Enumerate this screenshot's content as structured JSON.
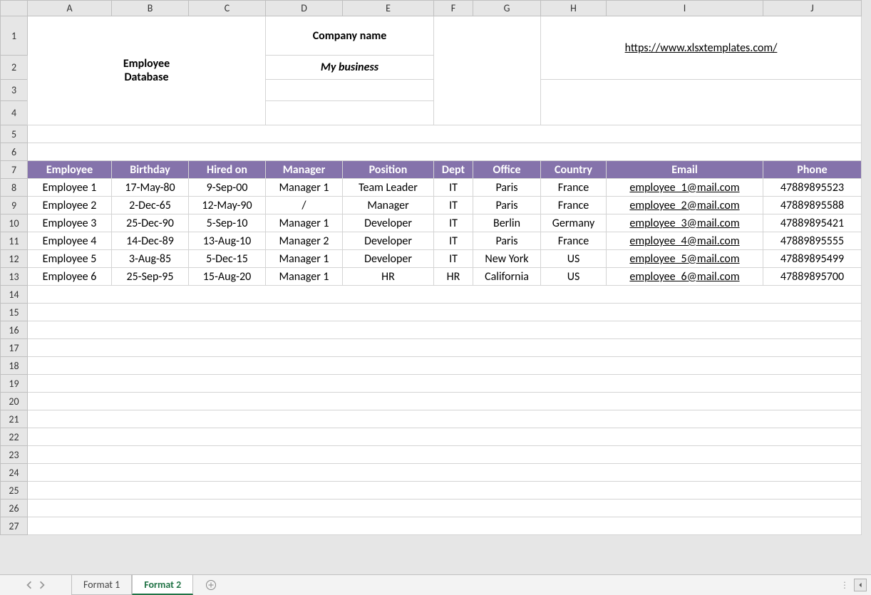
{
  "columns": [
    "A",
    "B",
    "C",
    "D",
    "E",
    "F",
    "G",
    "H",
    "I",
    "J"
  ],
  "rows": [
    "1",
    "2",
    "3",
    "4",
    "5",
    "6",
    "7",
    "8",
    "9",
    "10",
    "11",
    "12",
    "13",
    "14",
    "15",
    "16",
    "17",
    "18",
    "19",
    "20",
    "21",
    "22",
    "23",
    "24",
    "25",
    "26",
    "27"
  ],
  "title": {
    "line1": "Employee",
    "line2": "Database"
  },
  "company": {
    "label": "Company name",
    "value": "My business"
  },
  "link": "https://www.xlsxtemplates.com/",
  "table": {
    "headers": [
      "Employee",
      "Birthday",
      "Hired on",
      "Manager",
      "Position",
      "Dept",
      "Office",
      "Country",
      "Email",
      "Phone"
    ],
    "rows": [
      {
        "employee": "Employee 1",
        "birthday": "17-May-80",
        "hired": "9-Sep-00",
        "manager": "Manager 1",
        "position": "Team Leader",
        "dept": "IT",
        "office": "Paris",
        "country": "France",
        "email": "employee_1@mail.com",
        "phone": "47889895523"
      },
      {
        "employee": "Employee 2",
        "birthday": "2-Dec-65",
        "hired": "12-May-90",
        "manager": "/",
        "position": "Manager",
        "dept": "IT",
        "office": "Paris",
        "country": "France",
        "email": "employee_2@mail.com",
        "phone": "47889895588"
      },
      {
        "employee": "Employee 3",
        "birthday": "25-Dec-90",
        "hired": "5-Sep-10",
        "manager": "Manager 1",
        "position": "Developer",
        "dept": "IT",
        "office": "Berlin",
        "country": "Germany",
        "email": "employee_3@mail.com",
        "phone": "47889895421"
      },
      {
        "employee": "Employee 4",
        "birthday": "14-Dec-89",
        "hired": "13-Aug-10",
        "manager": "Manager 2",
        "position": "Developer",
        "dept": "IT",
        "office": "Paris",
        "country": "France",
        "email": "employee_4@mail.com",
        "phone": "47889895555"
      },
      {
        "employee": "Employee 5",
        "birthday": "3-Aug-85",
        "hired": "5-Dec-15",
        "manager": "Manager 1",
        "position": "Developer",
        "dept": "IT",
        "office": "New York",
        "country": "US",
        "email": "employee_5@mail.com",
        "phone": "47889895499"
      },
      {
        "employee": "Employee 6",
        "birthday": "25-Sep-95",
        "hired": "15-Aug-20",
        "manager": "Manager 1",
        "position": "HR",
        "dept": "HR",
        "office": "California",
        "country": "US",
        "email": "employee_6@mail.com",
        "phone": "47889895700"
      }
    ]
  },
  "tabs": {
    "items": [
      {
        "label": "Format 1",
        "active": false
      },
      {
        "label": "Format 2",
        "active": true
      }
    ]
  }
}
